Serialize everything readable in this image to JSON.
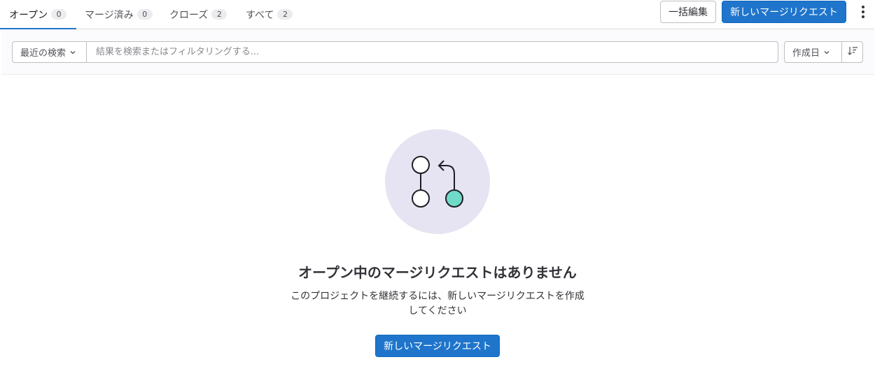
{
  "tabs": [
    {
      "label": "オープン",
      "count": "0"
    },
    {
      "label": "マージ済み",
      "count": "0"
    },
    {
      "label": "クローズ",
      "count": "2"
    },
    {
      "label": "すべて",
      "count": "2"
    }
  ],
  "actions": {
    "bulk_edit": "一括編集",
    "new_merge_request": "新しいマージリクエスト"
  },
  "filter": {
    "recent_searches": "最近の検索",
    "search_placeholder": "結果を検索またはフィルタリングする...",
    "search_value": "",
    "sort_field": "作成日"
  },
  "empty_state": {
    "title": "オープン中のマージリクエストはありません",
    "description_line1": "このプロジェクトを継続するには、新しいマージリクエストを作成",
    "description_line2": "してください",
    "button": "新しいマージリクエスト"
  },
  "colors": {
    "accent": "#1f75cb",
    "illustration_bg": "#e6e4f2",
    "illustration_node": "#6fdac8"
  },
  "icons": [
    "chevron-down-icon",
    "sort-icon",
    "kebab-icon",
    "merge-request-icon"
  ]
}
